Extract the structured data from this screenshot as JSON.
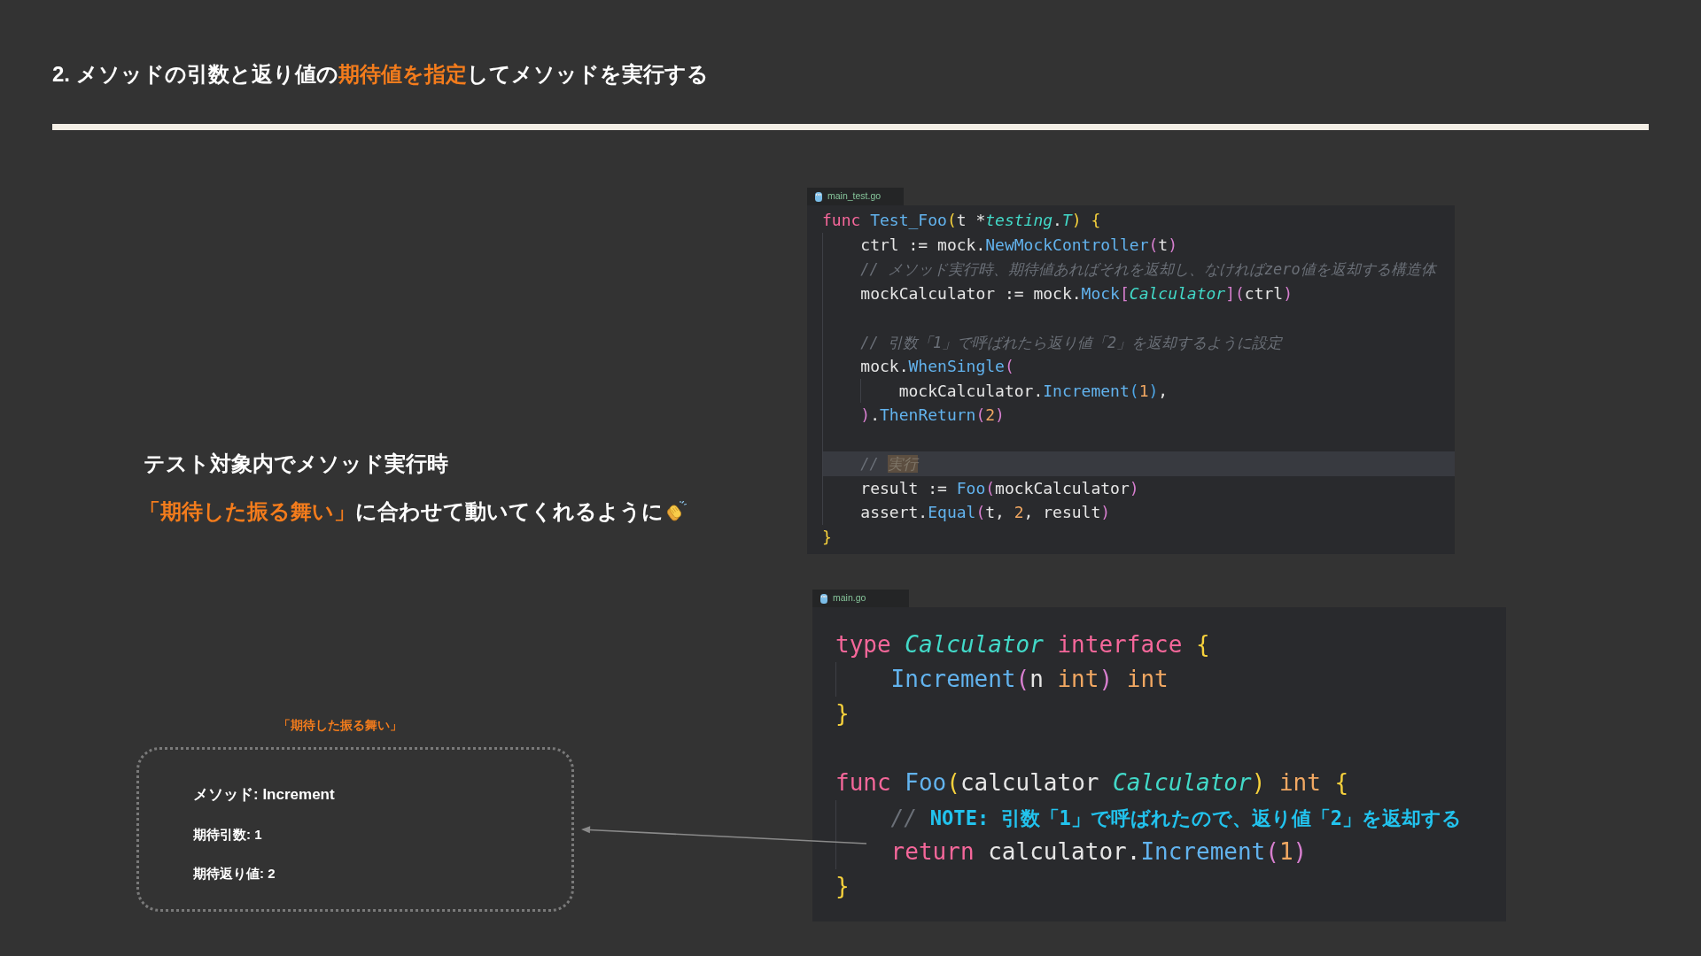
{
  "title": [
    {
      "text": "2. メソッドの引数と返り値の",
      "emphasis": false
    },
    {
      "text": "期待値を指定",
      "emphasis": true
    },
    {
      "text": "してメソッドを実行する",
      "emphasis": false
    }
  ],
  "lead": {
    "lines": [
      {
        "segments": [
          {
            "text": "テスト対象内でメソッド実行時",
            "emphasis": false
          }
        ]
      },
      {
        "segments": [
          {
            "text": "「期待した振る舞い」",
            "emphasis": true
          },
          {
            "text": "に合わせて動いてくれるように",
            "emphasis": false
          }
        ]
      }
    ]
  },
  "expectation": {
    "label": "「期待した振る舞い」",
    "items": [
      {
        "kind": "heading",
        "text": "メソッド: Increment"
      },
      {
        "kind": "field",
        "text": "期待引数: 1"
      },
      {
        "kind": "field",
        "text": "期待返り値: 2"
      }
    ]
  },
  "code_panels": [
    {
      "tab": "main_test.go",
      "lines": [
        {
          "kind": "code",
          "active": false,
          "tokens": [
            {
              "kind": "keyword",
              "text": "func "
            },
            {
              "kind": "function",
              "text": "Test_Foo"
            },
            {
              "kind": "bracket",
              "text": "("
            },
            {
              "kind": "plain",
              "text": "t *"
            },
            {
              "kind": "type",
              "text": "testing"
            },
            {
              "kind": "plain",
              "text": "."
            },
            {
              "kind": "type",
              "text": "T"
            },
            {
              "kind": "bracket",
              "text": ") {"
            }
          ]
        },
        {
          "kind": "code",
          "active": false,
          "tokens": [
            {
              "kind": "plain",
              "text": "    ctrl := mock."
            },
            {
              "kind": "function",
              "text": "NewMockController"
            },
            {
              "kind": "paren",
              "text": "("
            },
            {
              "kind": "plain",
              "text": "t"
            },
            {
              "kind": "paren",
              "text": ")"
            }
          ]
        },
        {
          "kind": "code",
          "active": false,
          "tokens": [
            {
              "kind": "comment",
              "text": "    // メソッド実行時、期待値あればそれを返却し、なければzero値を返却する構造体"
            }
          ]
        },
        {
          "kind": "code",
          "active": false,
          "tokens": [
            {
              "kind": "plain",
              "text": "    mockCalculator := mock."
            },
            {
              "kind": "function",
              "text": "Mock"
            },
            {
              "kind": "paren",
              "text": "["
            },
            {
              "kind": "type",
              "text": "Calculator"
            },
            {
              "kind": "paren",
              "text": "]("
            },
            {
              "kind": "plain",
              "text": "ctrl"
            },
            {
              "kind": "paren",
              "text": ")"
            }
          ]
        },
        {
          "kind": "blank",
          "active": false
        },
        {
          "kind": "code",
          "active": false,
          "tokens": [
            {
              "kind": "comment",
              "text": "    // 引数「1」で呼ばれたら返り値「2」を返却するように設定"
            }
          ]
        },
        {
          "kind": "code",
          "active": false,
          "tokens": [
            {
              "kind": "plain",
              "text": "    mock."
            },
            {
              "kind": "function",
              "text": "WhenSingle"
            },
            {
              "kind": "paren",
              "text": "("
            }
          ]
        },
        {
          "kind": "code",
          "active": false,
          "tokens": [
            {
              "kind": "plain",
              "text": "        mockCalculator."
            },
            {
              "kind": "function",
              "text": "Increment"
            },
            {
              "kind": "subparen",
              "text": "("
            },
            {
              "kind": "number",
              "text": "1"
            },
            {
              "kind": "subparen",
              "text": ")"
            },
            {
              "kind": "plain",
              "text": ","
            }
          ]
        },
        {
          "kind": "code",
          "active": false,
          "tokens": [
            {
              "kind": "paren",
              "text": "    )"
            },
            {
              "kind": "plain",
              "text": "."
            },
            {
              "kind": "function",
              "text": "ThenReturn"
            },
            {
              "kind": "paren",
              "text": "("
            },
            {
              "kind": "number",
              "text": "2"
            },
            {
              "kind": "paren",
              "text": ")"
            }
          ]
        },
        {
          "kind": "blank",
          "active": false
        },
        {
          "kind": "code",
          "active": true,
          "tokens": [
            {
              "kind": "comment",
              "text": "    // "
            },
            {
              "kind": "selection",
              "text": "実行"
            }
          ]
        },
        {
          "kind": "code",
          "active": false,
          "tokens": [
            {
              "kind": "plain",
              "text": "    result := "
            },
            {
              "kind": "function",
              "text": "Foo"
            },
            {
              "kind": "paren",
              "text": "("
            },
            {
              "kind": "plain",
              "text": "mockCalculator"
            },
            {
              "kind": "paren",
              "text": ")"
            }
          ]
        },
        {
          "kind": "code",
          "active": false,
          "tokens": [
            {
              "kind": "plain",
              "text": "    assert."
            },
            {
              "kind": "function",
              "text": "Equal"
            },
            {
              "kind": "paren",
              "text": "("
            },
            {
              "kind": "plain",
              "text": "t, "
            },
            {
              "kind": "number",
              "text": "2"
            },
            {
              "kind": "plain",
              "text": ", result"
            },
            {
              "kind": "paren",
              "text": ")"
            }
          ]
        },
        {
          "kind": "code",
          "active": false,
          "tokens": [
            {
              "kind": "bracket",
              "text": "}"
            }
          ]
        }
      ]
    },
    {
      "tab": "main.go",
      "lines": [
        {
          "kind": "code",
          "tokens": [
            {
              "kind": "keyword",
              "text": "type "
            },
            {
              "kind": "type",
              "text": "Calculator "
            },
            {
              "kind": "keyword",
              "text": "interface "
            },
            {
              "kind": "bracket",
              "text": "{"
            }
          ]
        },
        {
          "kind": "code",
          "tokens": [
            {
              "kind": "function",
              "text": "    Increment"
            },
            {
              "kind": "paren",
              "text": "("
            },
            {
              "kind": "plain",
              "text": "n "
            },
            {
              "kind": "builtin",
              "text": "int"
            },
            {
              "kind": "paren",
              "text": ")"
            },
            {
              "kind": "builtin",
              "text": " int"
            }
          ]
        },
        {
          "kind": "code",
          "tokens": [
            {
              "kind": "bracket",
              "text": "}"
            }
          ]
        },
        {
          "kind": "blank"
        },
        {
          "kind": "code",
          "tokens": [
            {
              "kind": "keyword",
              "text": "func "
            },
            {
              "kind": "function",
              "text": "Foo"
            },
            {
              "kind": "bracket",
              "text": "("
            },
            {
              "kind": "plain",
              "text": "calculator "
            },
            {
              "kind": "type",
              "text": "Calculator"
            },
            {
              "kind": "bracket",
              "text": ")"
            },
            {
              "kind": "builtin",
              "text": " int"
            },
            {
              "kind": "bracket",
              "text": " {"
            }
          ]
        },
        {
          "kind": "code",
          "tokens": [
            {
              "kind": "comment",
              "text": "    // "
            },
            {
              "kind": "note",
              "text": "NOTE: 引数「1」で呼ばれたので、返り値「2」を返却する"
            }
          ]
        },
        {
          "kind": "code",
          "tokens": [
            {
              "kind": "keyword",
              "text": "    return"
            },
            {
              "kind": "plain",
              "text": " calculator."
            },
            {
              "kind": "function",
              "text": "Increment"
            },
            {
              "kind": "paren",
              "text": "("
            },
            {
              "kind": "number",
              "text": "1"
            },
            {
              "kind": "paren",
              "text": ")"
            }
          ]
        },
        {
          "kind": "code",
          "tokens": [
            {
              "kind": "bracket",
              "text": "}"
            }
          ]
        }
      ]
    }
  ]
}
